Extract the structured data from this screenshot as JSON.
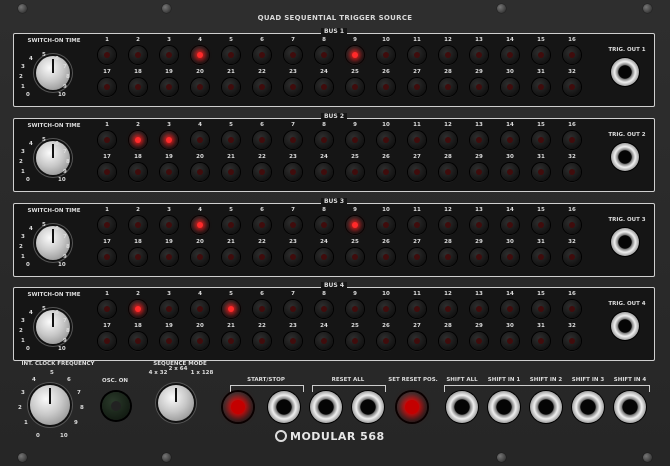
{
  "title": "QUAD SEQUENTIAL TRIGGER SOURCE",
  "switch_on_label": "SWITCH-ON TIME",
  "scale": [
    "0",
    "1",
    "2",
    "3",
    "4",
    "5",
    "6",
    "7",
    "8",
    "9",
    "10"
  ],
  "steps": [
    "1",
    "2",
    "3",
    "4",
    "5",
    "6",
    "7",
    "8",
    "9",
    "10",
    "11",
    "12",
    "13",
    "14",
    "15",
    "16",
    "17",
    "18",
    "19",
    "20",
    "21",
    "22",
    "23",
    "24",
    "25",
    "26",
    "27",
    "28",
    "29",
    "30",
    "31",
    "32"
  ],
  "buses": [
    {
      "label": "BUS 1",
      "out": "TRIG. OUT 1",
      "lit": [
        4,
        9
      ]
    },
    {
      "label": "BUS 2",
      "out": "TRIG. OUT 2",
      "lit": [
        2,
        3
      ]
    },
    {
      "label": "BUS 3",
      "out": "TRIG. OUT 3",
      "lit": [
        4,
        9
      ]
    },
    {
      "label": "BUS 4",
      "out": "TRIG. OUT 4",
      "lit": [
        2,
        5
      ]
    }
  ],
  "bottom": {
    "clock_label": "INT. CLOCK FREQUENCY",
    "osc_label": "OSC. ON",
    "mode_label": "SEQUENCE MODE",
    "mode_options": [
      "4 x 32",
      "2 x 64",
      "1 x 128"
    ],
    "start_stop": "START/STOP",
    "reset_all": "RESET ALL",
    "set_reset": "SET RESET POS.",
    "shift_all": "SHIFT ALL",
    "shift_1": "SHIFT IN 1",
    "shift_2": "SHIFT IN 2",
    "shift_3": "SHIFT IN 3",
    "shift_4": "SHIFT IN 4"
  },
  "brand": "MODULAR 568"
}
